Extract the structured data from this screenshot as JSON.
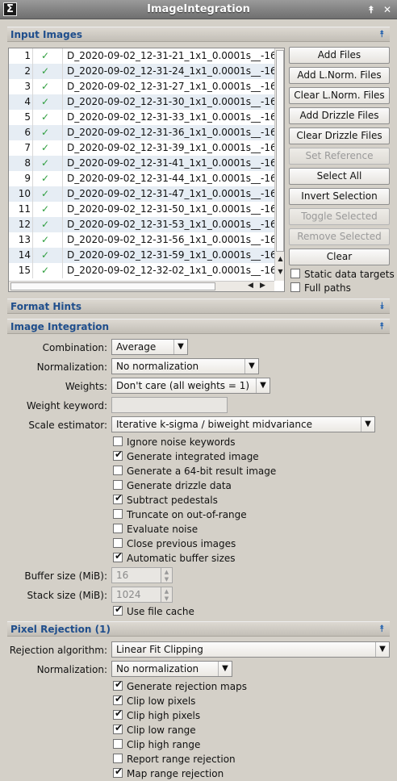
{
  "window": {
    "title": "ImageIntegration",
    "icon": "sigma-icon",
    "icon_glyph": "Σ",
    "minimize_glyph": "⯭",
    "close_glyph": "✕"
  },
  "sections": {
    "input_images": "Input Images",
    "format_hints": "Format Hints",
    "image_integration": "Image Integration",
    "pixel_rejection": "Pixel Rejection (1)",
    "expanded_glyph": "⯭",
    "collapsed_glyph": "⯯"
  },
  "file_list": {
    "rows": [
      {
        "num": "1",
        "check": "✓",
        "name": "D_2020-09-02_12-31-21_1x1_0.0001s__-16"
      },
      {
        "num": "2",
        "check": "✓",
        "name": "D_2020-09-02_12-31-24_1x1_0.0001s__-16"
      },
      {
        "num": "3",
        "check": "✓",
        "name": "D_2020-09-02_12-31-27_1x1_0.0001s__-16"
      },
      {
        "num": "4",
        "check": "✓",
        "name": "D_2020-09-02_12-31-30_1x1_0.0001s__-16"
      },
      {
        "num": "5",
        "check": "✓",
        "name": "D_2020-09-02_12-31-33_1x1_0.0001s__-16"
      },
      {
        "num": "6",
        "check": "✓",
        "name": "D_2020-09-02_12-31-36_1x1_0.0001s__-16"
      },
      {
        "num": "7",
        "check": "✓",
        "name": "D_2020-09-02_12-31-39_1x1_0.0001s__-16"
      },
      {
        "num": "8",
        "check": "✓",
        "name": "D_2020-09-02_12-31-41_1x1_0.0001s__-16"
      },
      {
        "num": "9",
        "check": "✓",
        "name": "D_2020-09-02_12-31-44_1x1_0.0001s__-16"
      },
      {
        "num": "10",
        "check": "✓",
        "name": "D_2020-09-02_12-31-47_1x1_0.0001s__-16"
      },
      {
        "num": "11",
        "check": "✓",
        "name": "D_2020-09-02_12-31-50_1x1_0.0001s__-16"
      },
      {
        "num": "12",
        "check": "✓",
        "name": "D_2020-09-02_12-31-53_1x1_0.0001s__-16"
      },
      {
        "num": "13",
        "check": "✓",
        "name": "D_2020-09-02_12-31-56_1x1_0.0001s__-16"
      },
      {
        "num": "14",
        "check": "✓",
        "name": "D_2020-09-02_12-31-59_1x1_0.0001s__-16"
      },
      {
        "num": "15",
        "check": "✓",
        "name": "D_2020-09-02_12-32-02_1x1_0.0001s__-16"
      }
    ],
    "scroll_up": "▲",
    "scroll_down": "▼",
    "scroll_left": "◀",
    "scroll_right": "▶"
  },
  "buttons": {
    "add_files": "Add Files",
    "add_lnorm": "Add L.Norm. Files",
    "clear_lnorm": "Clear L.Norm. Files",
    "add_drizzle": "Add Drizzle Files",
    "clear_drizzle": "Clear Drizzle Files",
    "set_reference": "Set Reference",
    "select_all": "Select All",
    "invert_selection": "Invert Selection",
    "toggle_selected": "Toggle Selected",
    "remove_selected": "Remove Selected",
    "clear": "Clear"
  },
  "list_options": {
    "static_targets": "Static data targets",
    "full_paths": "Full paths"
  },
  "integration": {
    "combination_label": "Combination:",
    "combination_value": "Average",
    "normalization_label": "Normalization:",
    "normalization_value": "No normalization",
    "weights_label": "Weights:",
    "weights_value": "Don't care (all weights = 1)",
    "weight_keyword_label": "Weight keyword:",
    "weight_keyword_value": "",
    "scale_estimator_label": "Scale estimator:",
    "scale_estimator_value": "Iterative k-sigma / biweight midvariance",
    "options": [
      {
        "label": "Ignore noise keywords",
        "checked": false
      },
      {
        "label": "Generate integrated image",
        "checked": true
      },
      {
        "label": "Generate a 64-bit result image",
        "checked": false
      },
      {
        "label": "Generate drizzle data",
        "checked": false
      },
      {
        "label": "Subtract pedestals",
        "checked": true
      },
      {
        "label": "Truncate on out-of-range",
        "checked": false
      },
      {
        "label": "Evaluate noise",
        "checked": false
      },
      {
        "label": "Close previous images",
        "checked": false
      },
      {
        "label": "Automatic buffer sizes",
        "checked": true
      }
    ],
    "buffer_size_label": "Buffer size (MiB):",
    "buffer_size_value": "16",
    "stack_size_label": "Stack size (MiB):",
    "stack_size_value": "1024",
    "use_file_cache": "Use file cache",
    "check_glyph": "✔",
    "dropdown_glyph": "▼",
    "spin_up": "▲",
    "spin_down": "▼"
  },
  "rejection": {
    "algorithm_label": "Rejection algorithm:",
    "algorithm_value": "Linear Fit Clipping",
    "normalization_label": "Normalization:",
    "normalization_value": "No normalization",
    "options": [
      {
        "label": "Generate rejection maps",
        "checked": true
      },
      {
        "label": "Clip low pixels",
        "checked": true
      },
      {
        "label": "Clip high pixels",
        "checked": true
      },
      {
        "label": "Clip low range",
        "checked": true
      },
      {
        "label": "Clip high range",
        "checked": false
      },
      {
        "label": "Report range rejection",
        "checked": false
      },
      {
        "label": "Map range rejection",
        "checked": true
      }
    ]
  }
}
